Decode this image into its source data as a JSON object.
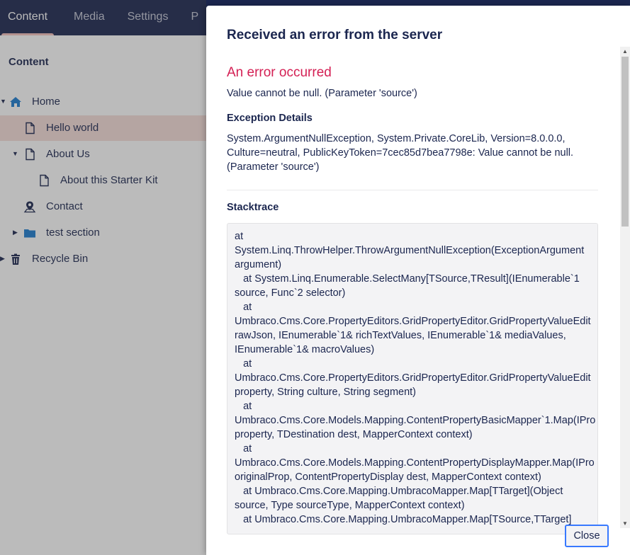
{
  "nav": {
    "tabs": [
      {
        "label": "Content"
      },
      {
        "label": "Media"
      },
      {
        "label": "Settings"
      },
      {
        "label": "P"
      }
    ]
  },
  "tree": {
    "header": "Content",
    "items": [
      {
        "label": "Home"
      },
      {
        "label": "Hello world"
      },
      {
        "label": "About Us"
      },
      {
        "label": "About this Starter Kit"
      },
      {
        "label": "Contact"
      },
      {
        "label": "test section"
      },
      {
        "label": "Recycle Bin"
      }
    ]
  },
  "dialog": {
    "title": "Received an error from the server",
    "error_title": "An error occurred",
    "error_message": "Value cannot be null. (Parameter 'source')",
    "exception_heading": "Exception Details",
    "exception_lines": [
      "System.ArgumentNullException, System.Private.CoreLib, Version=8.0.0.0,",
      "Culture=neutral, PublicKeyToken=7cec85d7bea7798e: Value cannot be null.",
      "(Parameter 'source')"
    ],
    "stacktrace_heading": "Stacktrace",
    "stacktrace_lines": [
      "at",
      "System.Linq.ThrowHelper.ThrowArgumentNullException(ExceptionArgument",
      "argument)",
      "   at System.Linq.Enumerable.SelectMany[TSource,TResult](IEnumerable`1",
      "source, Func`2 selector)",
      "   at",
      "Umbraco.Cms.Core.PropertyEditors.GridPropertyEditor.GridPropertyValueEdit",
      "rawJson, IEnumerable`1& richTextValues, IEnumerable`1& mediaValues,",
      "IEnumerable`1& macroValues)",
      "   at",
      "Umbraco.Cms.Core.PropertyEditors.GridPropertyEditor.GridPropertyValueEdit",
      "property, String culture, String segment)",
      "   at",
      "Umbraco.Cms.Core.Models.Mapping.ContentPropertyBasicMapper`1.Map(IPro",
      "property, TDestination dest, MapperContext context)",
      "   at",
      "Umbraco.Cms.Core.Models.Mapping.ContentPropertyDisplayMapper.Map(IPro",
      "originalProp, ContentPropertyDisplay dest, MapperContext context)",
      "   at Umbraco.Cms.Core.Mapping.UmbracoMapper.Map[TTarget](Object",
      "source, Type sourceType, MapperContext context)",
      "   at Umbraco.Cms.Core.Mapping.UmbracoMapper.Map[TSource,TTarget]"
    ],
    "close_label": "Close"
  },
  "colors": {
    "nav_bg": "#1b264f",
    "accent_error": "#d42054",
    "selected_row": "#f6ddd9",
    "icon_blue": "#1b7bd0",
    "focus_blue": "#3879ff"
  }
}
